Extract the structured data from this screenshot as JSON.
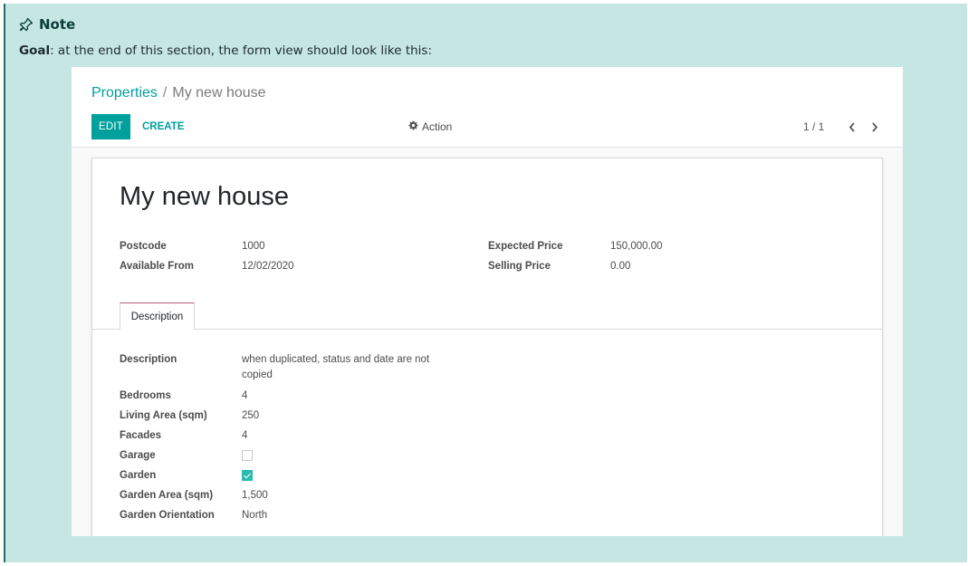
{
  "note": {
    "title": "Note",
    "goal_label": "Goal",
    "goal_text": ": at the end of this section, the form view should look like this:"
  },
  "breadcrumb": {
    "parent": "Properties",
    "separator": "/",
    "current": "My new house"
  },
  "toolbar": {
    "edit_label": "EDIT",
    "create_label": "CREATE",
    "action_label": "Action",
    "pager_text": "1 / 1"
  },
  "record": {
    "title": "My new house",
    "fields_left": [
      {
        "label": "Postcode",
        "value": "1000"
      },
      {
        "label": "Available From",
        "value": "12/02/2020"
      }
    ],
    "fields_right": [
      {
        "label": "Expected Price",
        "value": "150,000.00"
      },
      {
        "label": "Selling Price",
        "value": "0.00"
      }
    ]
  },
  "tabs": [
    {
      "label": "Description",
      "active": true
    }
  ],
  "description": {
    "fields": [
      {
        "label": "Description",
        "value": "when duplicated, status and date are not copied"
      },
      {
        "label": "Bedrooms",
        "value": "4"
      },
      {
        "label": "Living Area (sqm)",
        "value": "250"
      },
      {
        "label": "Facades",
        "value": "4"
      },
      {
        "label": "Garage",
        "checked": false
      },
      {
        "label": "Garden",
        "checked": true
      },
      {
        "label": "Garden Area (sqm)",
        "value": "1,500"
      },
      {
        "label": "Garden Orientation",
        "value": "North"
      }
    ]
  },
  "colors": {
    "note_bg": "#c5e6e3",
    "accent": "#00a09d",
    "checkbox_on": "#2bbab1"
  },
  "icons": {
    "note": "pin-icon",
    "action": "gear-icon",
    "prev": "chevron-left-icon",
    "next": "chevron-right-icon"
  }
}
